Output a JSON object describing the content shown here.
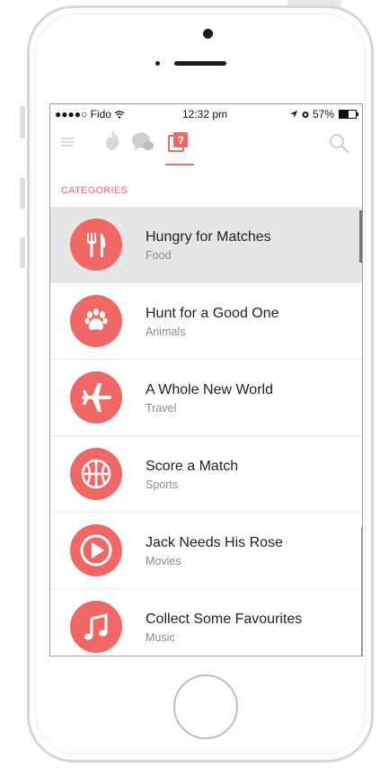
{
  "status_bar": {
    "carrier": "●●●●○ Fido",
    "time": "12:32 pm",
    "battery": "57%",
    "battery_level": 0.57
  },
  "navbar": {
    "icons": [
      "menu-icon",
      "flame-icon",
      "chat-icon",
      "categories-icon",
      "search-icon"
    ],
    "badge": "?"
  },
  "section": {
    "header": "CATEGORIES"
  },
  "categories": [
    {
      "title": "Hungry for Matches",
      "subtitle": "Food",
      "icon": "fork-knife-icon",
      "selected": true
    },
    {
      "title": "Hunt for a Good One",
      "subtitle": "Animals",
      "icon": "paw-icon",
      "selected": false
    },
    {
      "title": "A Whole New World",
      "subtitle": "Travel",
      "icon": "airplane-icon",
      "selected": false
    },
    {
      "title": "Score a Match",
      "subtitle": "Sports",
      "icon": "basketball-icon",
      "selected": false
    },
    {
      "title": "Jack Needs His Rose",
      "subtitle": "Movies",
      "icon": "play-icon",
      "selected": false
    },
    {
      "title": "Collect Some Favourites",
      "subtitle": "Music",
      "icon": "music-note-icon",
      "selected": false
    }
  ],
  "colors": {
    "accent": "#ef6866",
    "selected_row": "#e6e6e6"
  }
}
